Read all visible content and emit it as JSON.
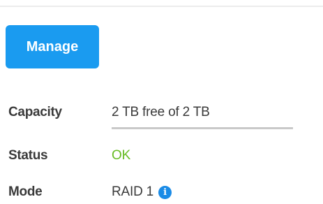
{
  "actions": {
    "manage_label": "Manage"
  },
  "details": {
    "capacity": {
      "label": "Capacity",
      "value": "2 TB free of 2 TB",
      "used_fraction": 0
    },
    "status": {
      "label": "Status",
      "value": "OK",
      "color": "#66bb22"
    },
    "mode": {
      "label": "Mode",
      "value": "RAID 1",
      "info_icon": "info-icon"
    }
  },
  "colors": {
    "accent": "#1a9bf0",
    "status_ok": "#66bb22",
    "info": "#1a8be6"
  }
}
